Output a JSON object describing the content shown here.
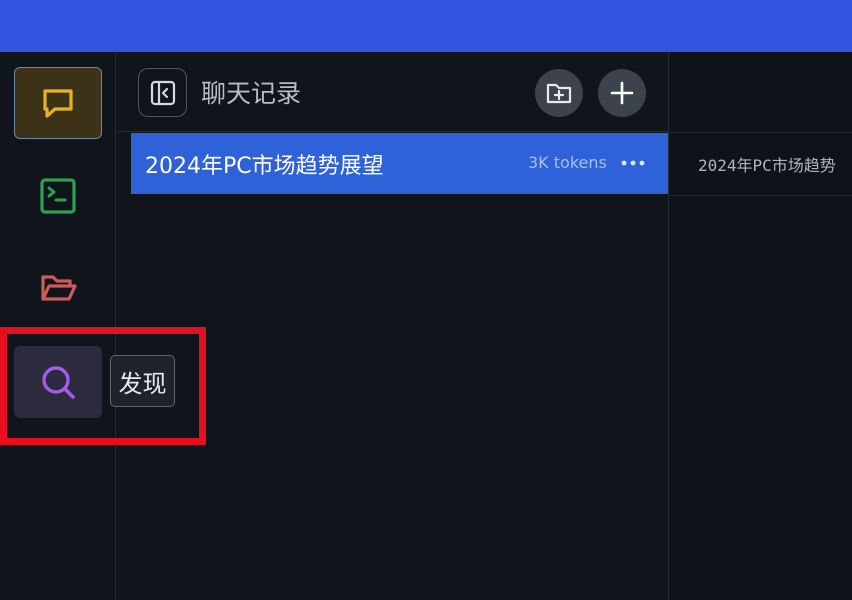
{
  "colors": {
    "topbar": "#3254e0",
    "background": "#0e131a",
    "selected_item": "#2f62d8",
    "chat_icon": "#e6b422",
    "terminal_icon": "#2ea04f",
    "folder_icon": "#cc5b5b",
    "search_icon": "#a35ce8",
    "highlight": "#e60e1f"
  },
  "activity_bar": {
    "items": [
      {
        "id": "chat",
        "icon": "chat-bubble-icon",
        "active": true
      },
      {
        "id": "terminal",
        "icon": "terminal-icon",
        "active": false
      },
      {
        "id": "files",
        "icon": "folder-open-icon",
        "active": false
      },
      {
        "id": "discover",
        "icon": "search-icon",
        "active": false,
        "hovered": true
      }
    ],
    "tooltip": "发现"
  },
  "chat_panel": {
    "title": "聊天记录",
    "collapse_icon": "sidebar-collapse-icon",
    "new_folder_icon": "folder-plus-icon",
    "add_icon": "plus-icon",
    "items": [
      {
        "title": "2024年PC市场趋势展望",
        "tokens": "3K tokens",
        "selected": true
      }
    ]
  },
  "main": {
    "tab_title": "2024年PC市场趋势"
  }
}
